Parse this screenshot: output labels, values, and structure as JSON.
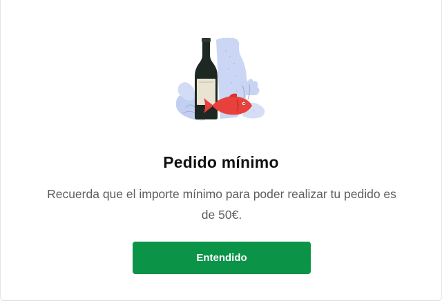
{
  "modal": {
    "illustration_icon": "wine-bottle-and-fish-icon",
    "title": "Pedido mínimo",
    "message": "Recuerda que el importe mínimo para poder realizar tu pedido es de 50€.",
    "button_label": "Entendido"
  },
  "colors": {
    "primary_button": "#0b9448",
    "button_text": "#ffffff",
    "title_text": "#111111",
    "body_text": "#5d5d5d",
    "fish": "#e8403b",
    "bottle": "#1f2a24",
    "background_shapes": "#c7d3f2"
  }
}
